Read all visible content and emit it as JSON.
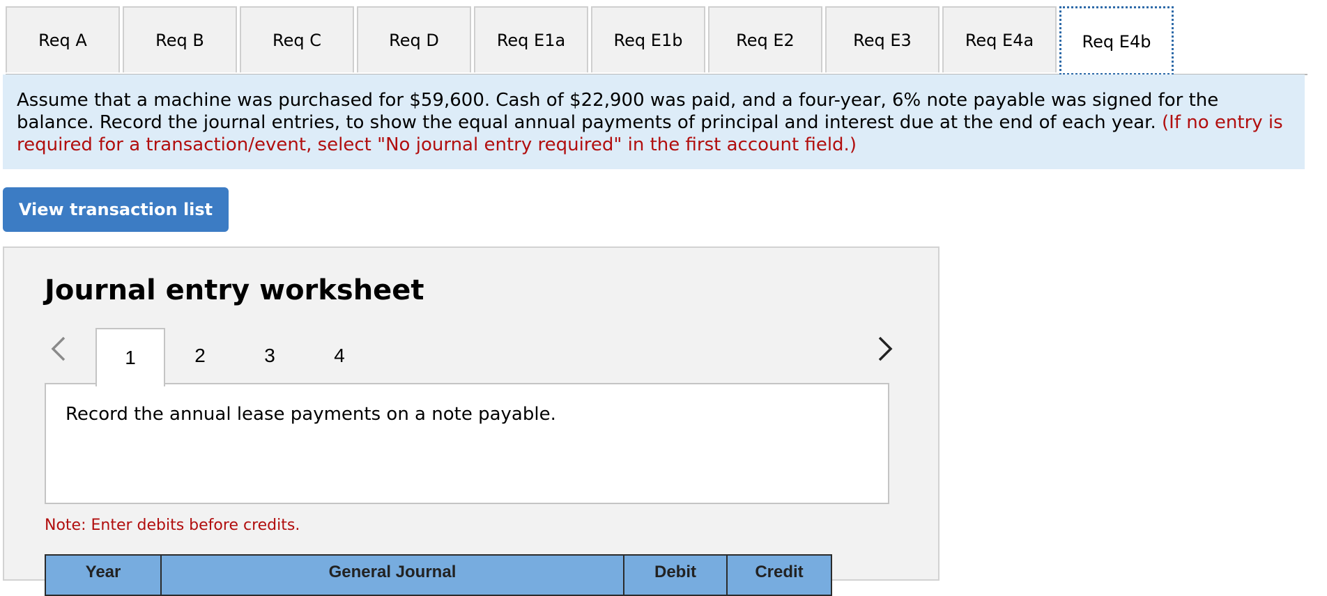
{
  "req_tabs": [
    {
      "label": "Req A",
      "active": false
    },
    {
      "label": "Req B",
      "active": false
    },
    {
      "label": "Req C",
      "active": false
    },
    {
      "label": "Req D",
      "active": false
    },
    {
      "label": "Req E1a",
      "active": false
    },
    {
      "label": "Req E1b",
      "active": false
    },
    {
      "label": "Req E2",
      "active": false
    },
    {
      "label": "Req E3",
      "active": false
    },
    {
      "label": "Req E4a",
      "active": false
    },
    {
      "label": "Req E4b",
      "active": true
    }
  ],
  "instructions": {
    "text": "Assume that a machine was purchased for $59,600. Cash of $22,900 was paid, and a four-year, 6% note payable was signed for the balance. Record the journal entries, to show the equal annual payments of principal and interest due at the end of each year. ",
    "hint": "(If no entry is required for a transaction/event, select \"No journal entry required\" in the first account field.)"
  },
  "view_transaction_button": "View transaction list",
  "worksheet": {
    "title": "Journal entry worksheet",
    "entry_tabs": [
      "1",
      "2",
      "3",
      "4"
    ],
    "active_entry": "1",
    "entry_description": "Record the annual lease payments on a note payable.",
    "note": "Note: Enter debits before credits.",
    "table_headers": [
      "Year",
      "General Journal",
      "Debit",
      "Credit"
    ]
  },
  "colors": {
    "accent": "#3c7cc4",
    "instruction_bg": "#ddecf8",
    "hint_red": "#b10e0e",
    "table_header": "#77acdf"
  },
  "icons": {
    "prev": "chevron-left-icon",
    "next": "chevron-right-icon"
  }
}
